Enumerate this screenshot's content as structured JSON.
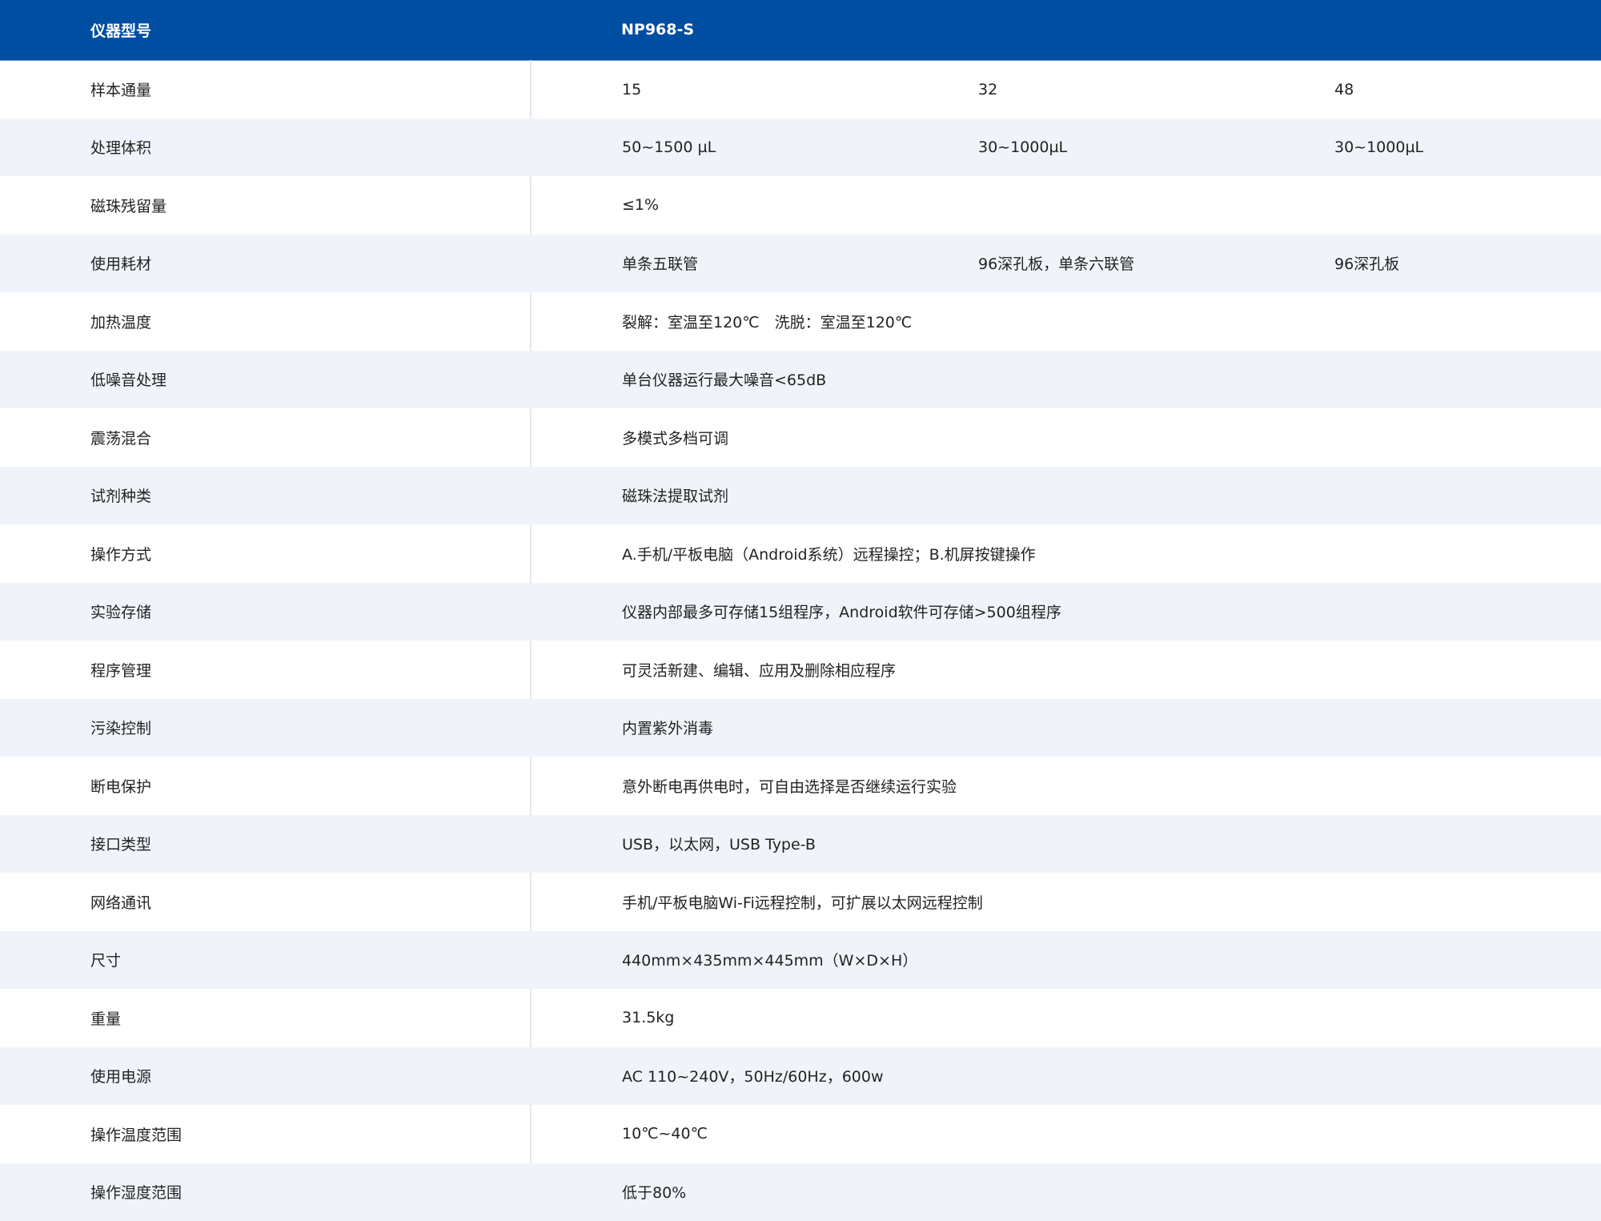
{
  "header": {
    "label": "仪器型号",
    "model": "NP968-S"
  },
  "rows": [
    {
      "label": "样本通量",
      "values": [
        "15",
        "32",
        "48"
      ]
    },
    {
      "label": "处理体积",
      "values": [
        "50~1500 µL",
        "30~1000µL",
        "30~1000µL"
      ]
    },
    {
      "label": "磁珠残留量",
      "value": "≤1%"
    },
    {
      "label": "使用耗材",
      "values": [
        "单条五联管",
        "96深孔板，单条六联管",
        "96深孔板"
      ]
    },
    {
      "label": "加热温度",
      "value": "裂解：室温至120℃　洗脱：室温至120℃"
    },
    {
      "label": "低噪音处理",
      "value": "单台仪器运行最大噪音<65dB"
    },
    {
      "label": "震荡混合",
      "value": "多模式多档可调"
    },
    {
      "label": "试剂种类",
      "value": "磁珠法提取试剂"
    },
    {
      "label": "操作方式",
      "value": "A.手机/平板电脑（Android系统）远程操控；B.机屏按键操作"
    },
    {
      "label": "实验存储",
      "value": "仪器内部最多可存储15组程序，Android软件可存储>500组程序"
    },
    {
      "label": "程序管理",
      "value": "可灵活新建、编辑、应用及删除相应程序"
    },
    {
      "label": "污染控制",
      "value": "内置紫外消毒"
    },
    {
      "label": "断电保护",
      "value": "意外断电再供电时，可自由选择是否继续运行实验"
    },
    {
      "label": "接口类型",
      "value": "USB，以太网，USB Type-B"
    },
    {
      "label": "网络通讯",
      "value": "手机/平板电脑Wi-Fi远程控制，可扩展以太网远程控制"
    },
    {
      "label": "尺寸",
      "value": "440mm×435mm×445mm（W×D×H）"
    },
    {
      "label": "重量",
      "value": "31.5kg"
    },
    {
      "label": "使用电源",
      "value": "AC 110~240V，50Hz/60Hz，600w"
    },
    {
      "label": "操作温度范围",
      "value": "10℃~40℃"
    },
    {
      "label": "操作湿度范围",
      "value": "低于80%"
    }
  ],
  "colors": {
    "header_bg": "#004ea2",
    "header_text": "#ffffff",
    "row_alt_bg": "#f0f4fa",
    "text": "#222222"
  }
}
